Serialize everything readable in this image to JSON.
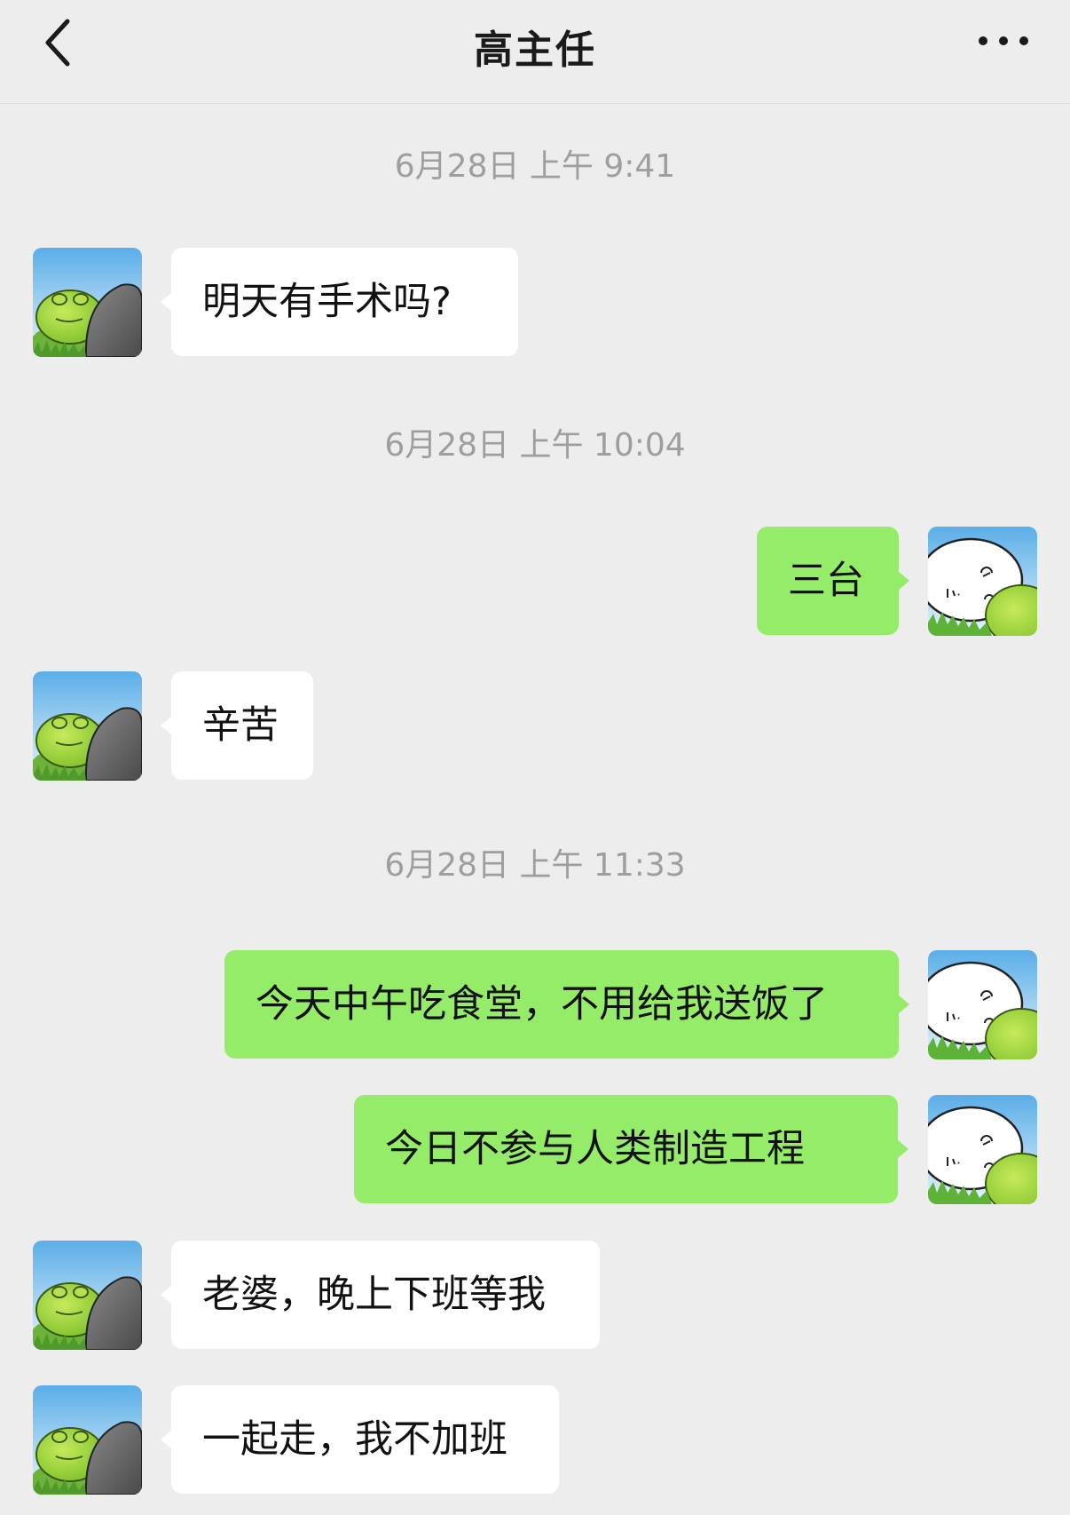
{
  "header": {
    "back_icon": "chevron-left-icon",
    "title": "高主任",
    "more_icon": "more-dots-icon"
  },
  "colors": {
    "background": "#ededed",
    "incoming_bubble": "#ffffff",
    "outgoing_bubble": "#95ec69",
    "timestamp_text": "#9e9e9e"
  },
  "chat": {
    "timestamps": [
      "6月28日 上午 9:41",
      "6月28日 上午 10:04",
      "6月28日 上午 11:33"
    ],
    "messages": [
      {
        "sender": "contact",
        "text": "明天有手术吗?"
      },
      {
        "sender": "me",
        "text": "三台"
      },
      {
        "sender": "contact",
        "text": "辛苦"
      },
      {
        "sender": "me",
        "text": "今天中午吃食堂，不用给我送饭了"
      },
      {
        "sender": "me",
        "text": "今日不参与人类制造工程"
      },
      {
        "sender": "contact",
        "text": "老婆，晚上下班等我"
      },
      {
        "sender": "contact",
        "text": "一起走，我不加班"
      }
    ]
  },
  "avatars": {
    "contact": "frog-and-rock-avatar",
    "me": "sleepy-face-avatar"
  }
}
